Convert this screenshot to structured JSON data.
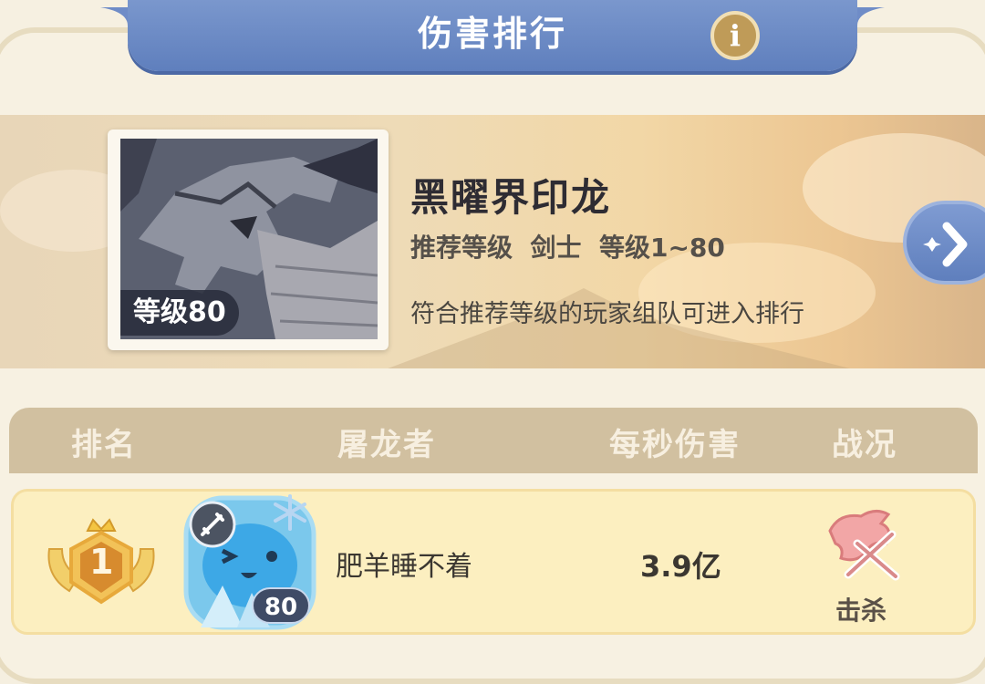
{
  "header": {
    "title": "伤害排行",
    "info_icon": "info-icon",
    "info_label": "i",
    "accent_color": "#6886c5"
  },
  "boss": {
    "name": "黑曜界印龙",
    "level_badge": "等级80",
    "recommend": "推荐等级  剑士  等级1~80",
    "note": "符合推荐等级的玩家组队可进入排行",
    "next_icon": "chevron-right-icon"
  },
  "table": {
    "columns": [
      "排名",
      "屠龙者",
      "每秒伤害",
      "战况"
    ],
    "rows": [
      {
        "rank": "1",
        "rank_icon": "gold-rank-medal-icon",
        "avatar_level": "80",
        "class_icon": "sword-class-icon",
        "buff_icon": "snowflake-icon",
        "player": "肥羊睡不着",
        "dps": "3.9亿",
        "status": "击杀",
        "status_icon": "dragon-kill-icon"
      }
    ]
  }
}
